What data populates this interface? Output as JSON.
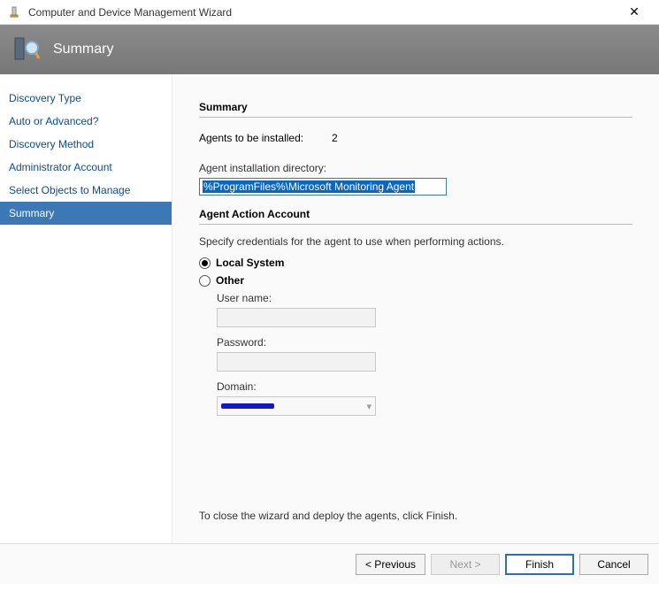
{
  "window": {
    "title": "Computer and Device Management Wizard"
  },
  "banner": {
    "title": "Summary"
  },
  "sidebar": {
    "items": [
      {
        "label": "Discovery Type"
      },
      {
        "label": "Auto or Advanced?"
      },
      {
        "label": "Discovery Method"
      },
      {
        "label": "Administrator Account"
      },
      {
        "label": "Select Objects to Manage"
      },
      {
        "label": "Summary"
      }
    ],
    "activeIndex": 5
  },
  "summary": {
    "heading": "Summary",
    "agents_label": "Agents to be installed:",
    "agents_count": "2",
    "install_dir_label": "Agent installation directory:",
    "install_dir_value": "%ProgramFiles%\\Microsoft Monitoring Agent",
    "action_account_heading": "Agent Action Account",
    "credentials_desc": "Specify credentials for the agent to use when performing actions.",
    "radio_local": "Local System",
    "radio_other": "Other",
    "username_label": "User name:",
    "username_value": "",
    "password_label": "Password:",
    "password_value": "",
    "domain_label": "Domain:",
    "domain_value_redacted": true,
    "close_desc": "To close the wizard and deploy the agents, click Finish."
  },
  "footer": {
    "previous": "< Previous",
    "next": "Next >",
    "finish": "Finish",
    "cancel": "Cancel"
  }
}
